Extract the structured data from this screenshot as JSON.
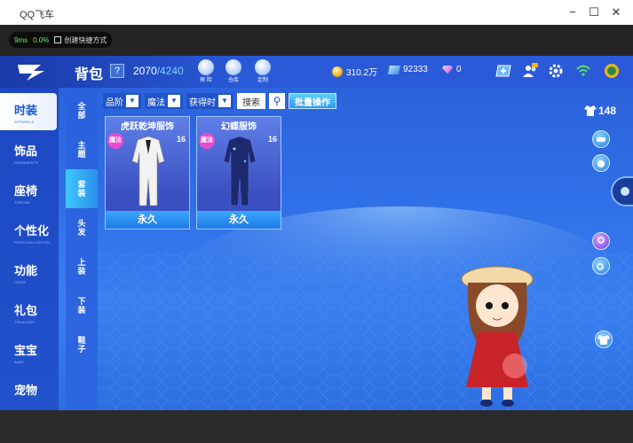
{
  "window": {
    "title": "QQ飞车",
    "minimize": "−",
    "maximize": "☐",
    "close": "✕"
  },
  "netbar": {
    "ping": "9ms",
    "loss": "0.0%",
    "shortcut_label": "创建快捷方式"
  },
  "header": {
    "title": "背包",
    "help": "?",
    "capacity_used": "2070",
    "capacity_max": "/4240",
    "icons": [
      {
        "name": "explore-icon",
        "label": "探 险"
      },
      {
        "name": "warehouse-icon",
        "label": "仓库"
      },
      {
        "name": "custom-icon",
        "label": "定制"
      }
    ],
    "coins": "310.2万",
    "diamonds": "92333",
    "gems": "0"
  },
  "left_nav": [
    {
      "label": "时装",
      "sub": "APPARELS",
      "active": true
    },
    {
      "label": "饰品",
      "sub": "ORNAMENTS",
      "active": false
    },
    {
      "label": "座椅",
      "sub": "THRONE",
      "active": false
    },
    {
      "label": "个性化",
      "sub": "PERSONALIZATION",
      "active": false
    },
    {
      "label": "功能",
      "sub": "ITEMS",
      "active": false
    },
    {
      "label": "礼包",
      "sub": "TREASURE",
      "active": false
    },
    {
      "label": "宝宝",
      "sub": "BABY",
      "active": false
    },
    {
      "label": "宠物",
      "sub": "",
      "active": false
    }
  ],
  "sub_nav": [
    {
      "label": "全部",
      "active": false
    },
    {
      "label": "主题",
      "active": false
    },
    {
      "label": "套装",
      "active": true
    },
    {
      "label": "头发",
      "active": false
    },
    {
      "label": "上装",
      "active": false
    },
    {
      "label": "下装",
      "active": false
    },
    {
      "label": "鞋子",
      "active": false
    }
  ],
  "filters": {
    "grade": "品阶",
    "magic": "魔法",
    "acquired": "获得时",
    "search": "搜索",
    "batch": "批量操作"
  },
  "items": [
    {
      "name": "虎跃乾坤服饰",
      "tag": "魔法",
      "level": "16",
      "duration": "永久",
      "color": "#f2f2f2"
    },
    {
      "name": "幻蝶服饰",
      "tag": "魔法",
      "level": "16",
      "duration": "永久",
      "color": "#1d2a6e"
    }
  ],
  "outfit_count": "148"
}
